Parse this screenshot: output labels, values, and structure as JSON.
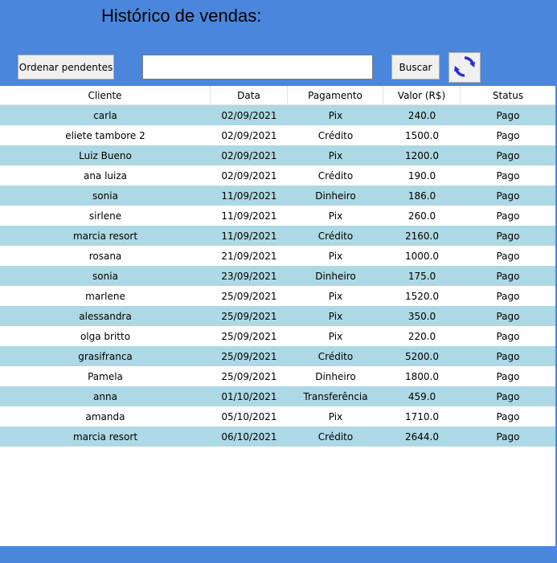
{
  "window": {
    "title": "Histórico de vendas:"
  },
  "toolbar": {
    "sort_label": "Ordenar pendentes",
    "search_value": "",
    "search_placeholder": "",
    "search_label": "Buscar",
    "refresh_icon": "refresh-icon"
  },
  "colors": {
    "accent": "#4a86dc",
    "row_alt": "#add8e6",
    "refresh_icon": "#2b2bd9"
  },
  "table": {
    "headers": [
      "Cliente",
      "Data",
      "Pagamento",
      "Valor (R$)",
      "Status"
    ],
    "rows": [
      [
        "carla",
        "02/09/2021",
        "Pix",
        "240.0",
        "Pago"
      ],
      [
        "eliete tambore 2",
        "02/09/2021",
        "Crédito",
        "1500.0",
        "Pago"
      ],
      [
        "Luiz Bueno",
        "02/09/2021",
        "Pix",
        "1200.0",
        "Pago"
      ],
      [
        "ana luiza",
        "02/09/2021",
        "Crédito",
        "190.0",
        "Pago"
      ],
      [
        "sonia",
        "11/09/2021",
        "Dinheiro",
        "186.0",
        "Pago"
      ],
      [
        "sirlene",
        "11/09/2021",
        "Pix",
        "260.0",
        "Pago"
      ],
      [
        "marcia resort",
        "11/09/2021",
        "Crédito",
        "2160.0",
        "Pago"
      ],
      [
        "rosana",
        "21/09/2021",
        "Pix",
        "1000.0",
        "Pago"
      ],
      [
        "sonia",
        "23/09/2021",
        "Dinheiro",
        "175.0",
        "Pago"
      ],
      [
        "marlene",
        "25/09/2021",
        "Pix",
        "1520.0",
        "Pago"
      ],
      [
        "alessandra",
        "25/09/2021",
        "Pix",
        "350.0",
        "Pago"
      ],
      [
        "olga britto",
        "25/09/2021",
        "Pix",
        "220.0",
        "Pago"
      ],
      [
        "grasifranca",
        "25/09/2021",
        "Crédito",
        "5200.0",
        "Pago"
      ],
      [
        "Pamela",
        "25/09/2021",
        "Dinheiro",
        "1800.0",
        "Pago"
      ],
      [
        "anna",
        "01/10/2021",
        "Transferência",
        "459.0",
        "Pago"
      ],
      [
        "amanda",
        "05/10/2021",
        "Pix",
        "1710.0",
        "Pago"
      ],
      [
        "marcia resort",
        "06/10/2021",
        "Crédito",
        "2644.0",
        "Pago"
      ]
    ]
  }
}
